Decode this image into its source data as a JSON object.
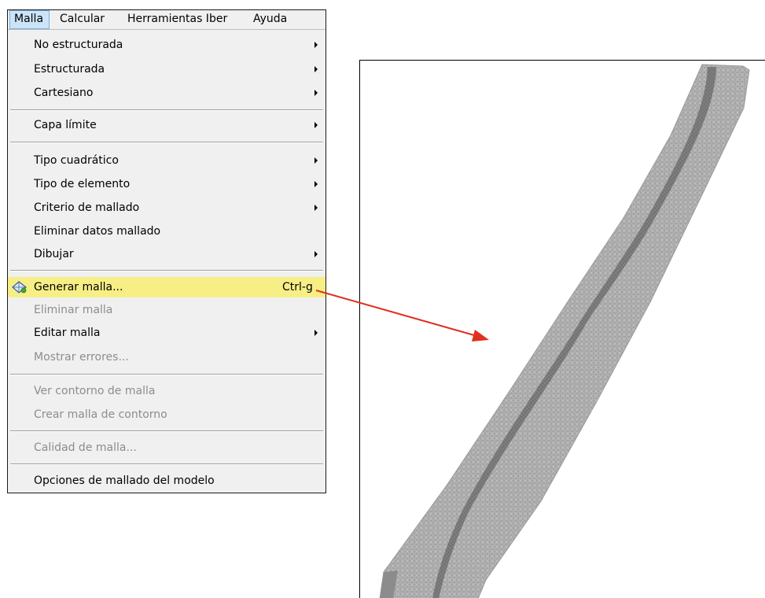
{
  "menubar": {
    "items": [
      "Malla",
      "Calcular",
      "Herramientas Iber",
      "Ayuda"
    ],
    "active": "Malla"
  },
  "menu": {
    "items": [
      {
        "label": "No estructurada",
        "submenu": true
      },
      {
        "label": "Estructurada",
        "submenu": true
      },
      {
        "label": "Cartesiano",
        "submenu": true
      },
      {
        "label": "Capa límite",
        "submenu": true
      },
      {
        "label": "Tipo cuadrático",
        "submenu": true
      },
      {
        "label": "Tipo de elemento",
        "submenu": true
      },
      {
        "label": "Criterio de mallado",
        "submenu": true
      },
      {
        "label": "Eliminar datos mallado",
        "submenu": false
      },
      {
        "label": "Dibujar",
        "submenu": true
      },
      {
        "label": "Generar malla...",
        "shortcut": "Ctrl-g",
        "highlighted": true,
        "icon": "generate-mesh-icon"
      },
      {
        "label": "Eliminar malla",
        "disabled": true
      },
      {
        "label": "Editar malla",
        "submenu": true
      },
      {
        "label": "Mostrar errores...",
        "disabled": true
      },
      {
        "label": "Ver contorno de malla",
        "disabled": true
      },
      {
        "label": "Crear malla de contorno",
        "disabled": true
      },
      {
        "label": "Calidad de malla...",
        "disabled": true
      },
      {
        "label": "Opciones de mallado del modelo",
        "submenu": false
      }
    ]
  },
  "colors": {
    "highlight": "#f7ef86",
    "disabled_text": "#8d8d8d",
    "arrow": "#e0301e",
    "mesh_gray": "#a8a8a8",
    "channel_gray": "#6f6f6f"
  }
}
